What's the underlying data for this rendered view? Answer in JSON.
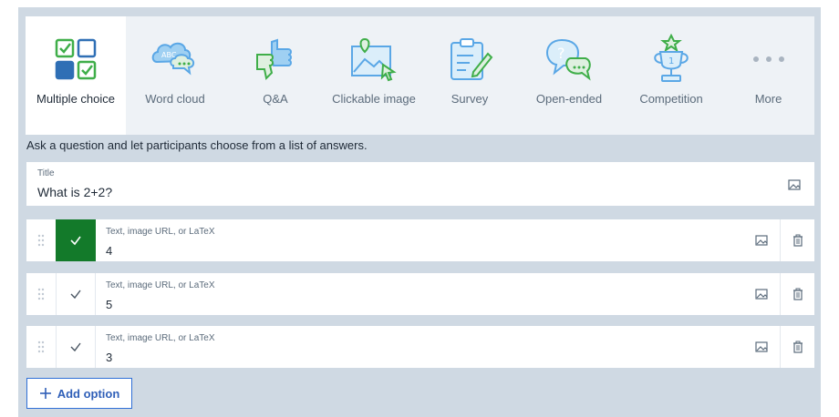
{
  "types": [
    {
      "label": "Multiple choice",
      "icon": "multiple-choice-icon",
      "active": true
    },
    {
      "label": "Word cloud",
      "icon": "word-cloud-icon",
      "active": false
    },
    {
      "label": "Q&A",
      "icon": "thumbs-icon",
      "active": false
    },
    {
      "label": "Clickable image",
      "icon": "clickable-image-icon",
      "active": false
    },
    {
      "label": "Survey",
      "icon": "survey-clipboard-icon",
      "active": false
    },
    {
      "label": "Open-ended",
      "icon": "open-ended-icon",
      "active": false
    },
    {
      "label": "Competition",
      "icon": "trophy-icon",
      "active": false
    },
    {
      "label": "More",
      "icon": "more-dots-icon",
      "active": false
    }
  ],
  "word_cloud_badge": "ABC",
  "description": "Ask a question and let participants choose from a list of answers.",
  "title_field": {
    "label": "Title",
    "value": "What is 2+2?"
  },
  "options": [
    {
      "placeholder": "Text, image URL, or LaTeX",
      "value": "4",
      "correct": true
    },
    {
      "placeholder": "Text, image URL, or LaTeX",
      "value": "5",
      "correct": false
    },
    {
      "placeholder": "Text, image URL, or LaTeX",
      "value": "3",
      "correct": false
    }
  ],
  "add_option_label": "Add option",
  "colors": {
    "panel_bg": "#cfd9e3",
    "tab_bg": "#eef2f6",
    "correct_green": "#137a2a",
    "icon_blue": "#5aa7e6",
    "icon_green": "#3fae49",
    "accent_blue": "#2f6fd6"
  }
}
